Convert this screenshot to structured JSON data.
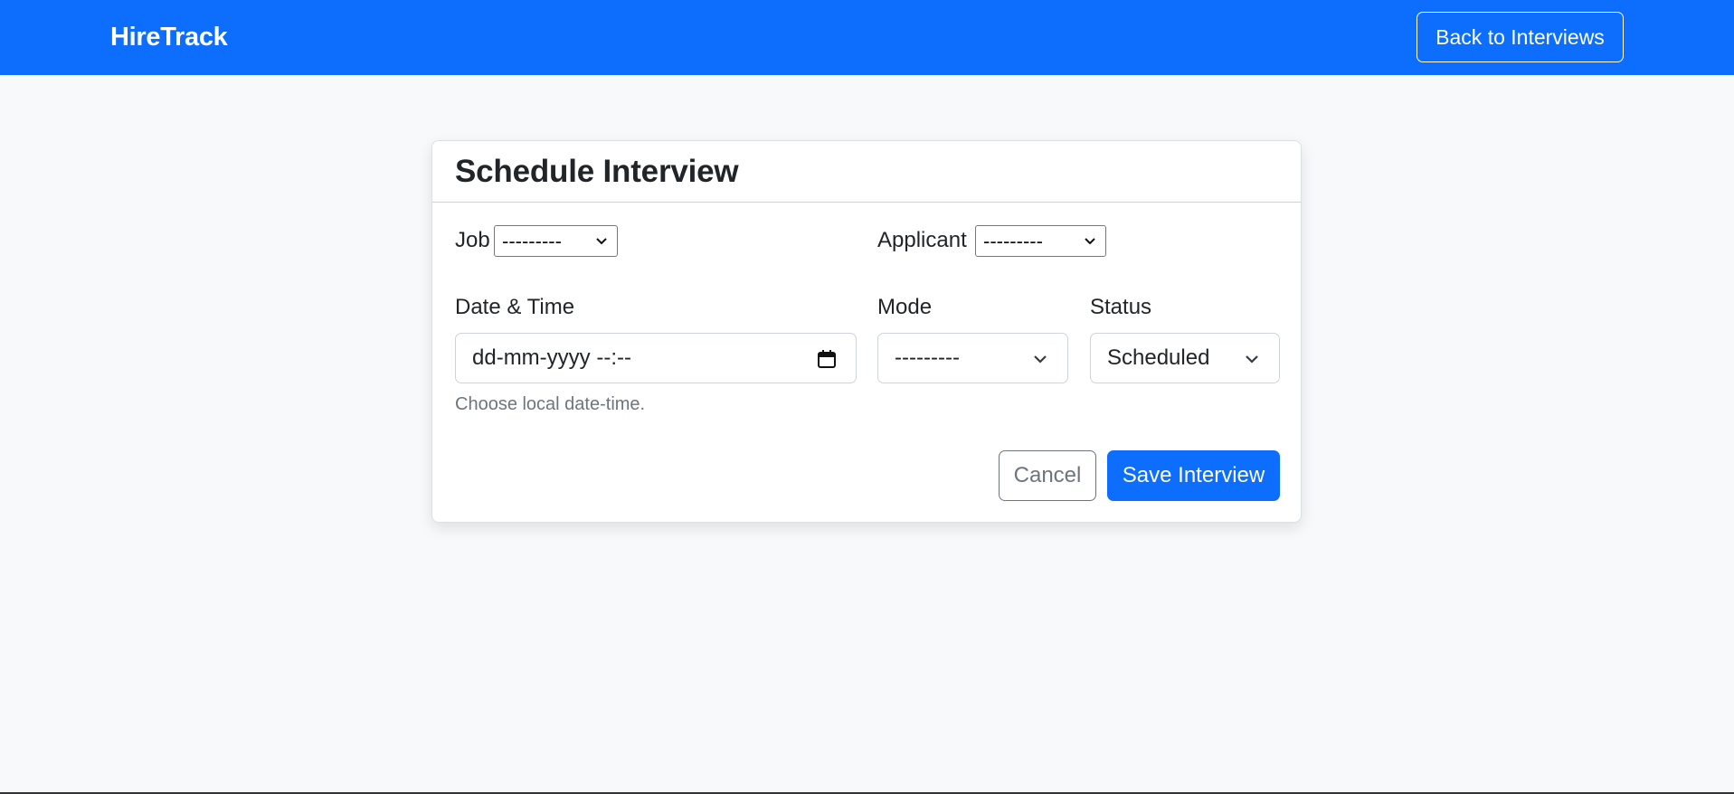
{
  "navbar": {
    "brand": "HireTrack",
    "back_button": "Back to Interviews"
  },
  "card": {
    "title": "Schedule Interview",
    "job": {
      "label": "Job",
      "selected": "---------"
    },
    "applicant": {
      "label": "Applicant",
      "selected": "---------"
    },
    "datetime": {
      "label": "Date & Time",
      "placeholder": "dd-mm-yyyy --:--",
      "help": "Choose local date-time."
    },
    "mode": {
      "label": "Mode",
      "selected": "---------"
    },
    "status": {
      "label": "Status",
      "selected": "Scheduled"
    },
    "cancel_button": "Cancel",
    "save_button": "Save Interview"
  },
  "colors": {
    "primary": "#0d6efd",
    "background": "#f8f9fa",
    "muted": "#6c757d"
  },
  "icons": {
    "chevron": "chevron-down-icon",
    "calendar": "calendar-icon"
  }
}
